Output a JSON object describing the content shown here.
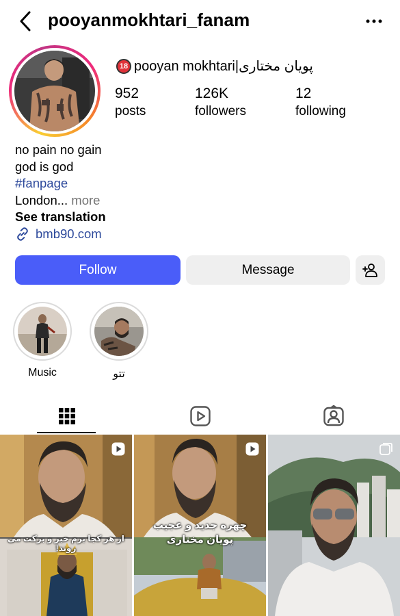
{
  "header": {
    "username": "pooyanmokhtari_fanam",
    "back_icon": "chevron-left-icon",
    "more_icon": "ellipsis-icon"
  },
  "profile": {
    "age_badge": "18",
    "display_name": "pooyan mokhtari|پویان مختاری"
  },
  "stats": {
    "posts": {
      "value": "952",
      "label": "posts"
    },
    "followers": {
      "value": "126K",
      "label": "followers"
    },
    "following": {
      "value": "12",
      "label": "following"
    }
  },
  "bio": {
    "line1": "no pain no gain",
    "line2": "god is god",
    "hashtag": "#fanpage",
    "location": "London...",
    "more": "more",
    "see_translation": "See translation",
    "link": "bmb90.com"
  },
  "actions": {
    "follow": "Follow",
    "message": "Message",
    "add_user_icon": "add-person-icon"
  },
  "highlights": [
    {
      "label": "Music"
    },
    {
      "label": "تتو"
    }
  ],
  "tabs": [
    {
      "name": "posts",
      "icon": "grid-icon"
    },
    {
      "name": "reels",
      "icon": "reels-icon"
    },
    {
      "name": "tagged",
      "icon": "tagged-icon"
    }
  ],
  "posts": [
    {
      "caption": "از هر کجا برم خبر و برکت می روند!",
      "type": "reel"
    },
    {
      "caption_line1": "چهره جدید و عجیب",
      "caption_line2": "پویان مختاری",
      "type": "reel"
    },
    {
      "type": "multi"
    }
  ],
  "colors": {
    "follow": "#4a5df9",
    "secondary_button": "#efefef",
    "link": "#2e4a9c",
    "muted": "#737373"
  }
}
